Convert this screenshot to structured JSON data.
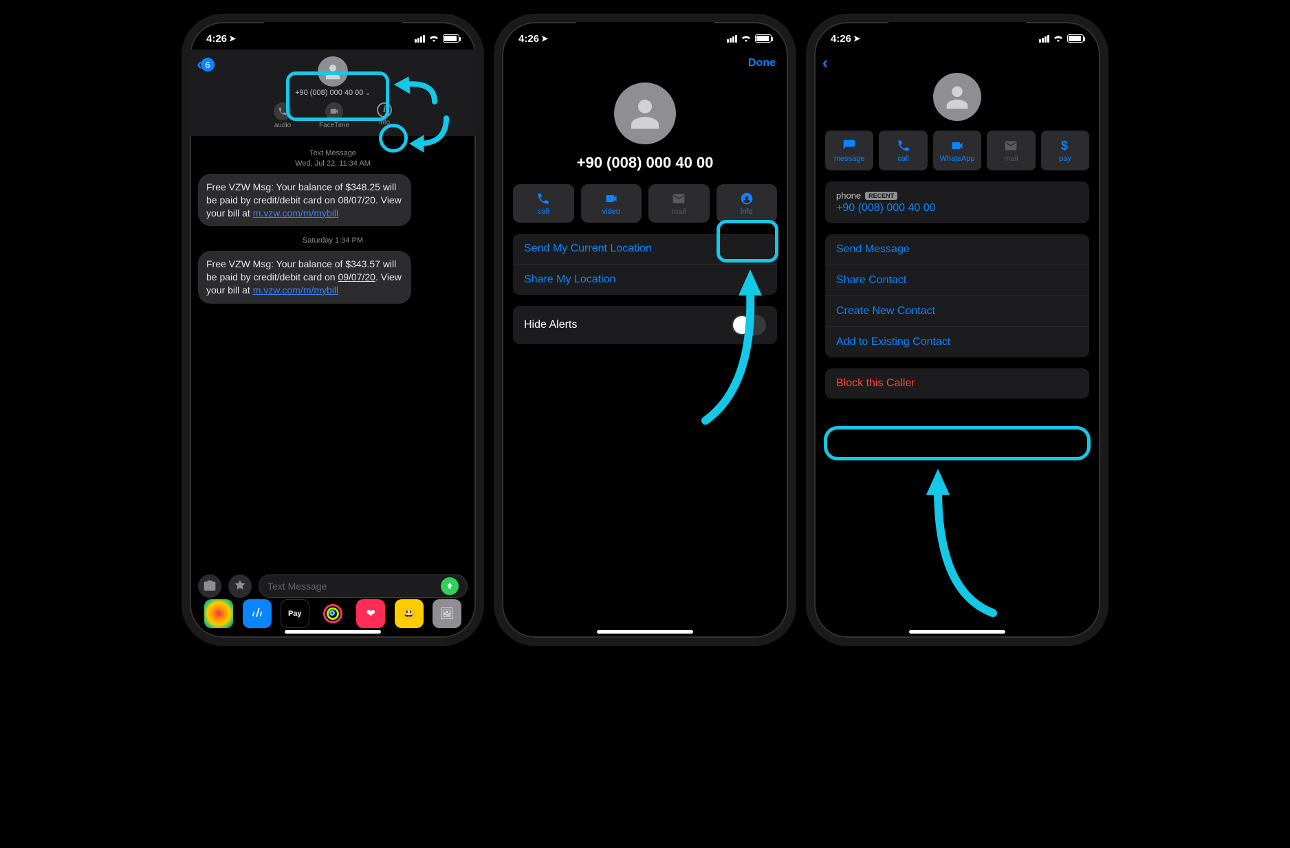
{
  "status": {
    "time": "4:26",
    "loc_icon": "➤"
  },
  "screen1": {
    "back_badge": "6",
    "contact_phone": "+90 (008) 000 40 00",
    "qa": {
      "audio": "audio",
      "facetime": "FaceTime",
      "info": "info"
    },
    "msg1": {
      "meta_line1": "Text Message",
      "meta_line2": "Wed, Jul 22, 11:34 AM",
      "text_a": "Free VZW Msg: Your balance of $348.25 will be paid by credit/debit card on 08/07/20. View your bill at ",
      "link": "m.vzw.com/m/mybill"
    },
    "msg2": {
      "meta": "Saturday 1:34 PM",
      "text_a": "Free VZW Msg: Your balance of $343.57 will be paid by credit/debit card on ",
      "date_txt": "09/07/20",
      "text_b": ". View your bill at ",
      "link": "m.vzw.com/m/mybill"
    },
    "compose_placeholder": "Text Message",
    "apay": "Pay"
  },
  "screen2": {
    "done": "Done",
    "phone": "+90 (008) 000 40 00",
    "actions": {
      "call": "call",
      "video": "video",
      "mail": "mail",
      "info": "info"
    },
    "send_loc": "Send My Current Location",
    "share_loc": "Share My Location",
    "hide_alerts": "Hide Alerts"
  },
  "screen3": {
    "actions": {
      "message": "message",
      "call": "call",
      "whatsapp": "WhatsApp",
      "mail": "mail",
      "pay": "pay"
    },
    "phone_label": "phone",
    "recent": "RECENT",
    "phone_value": "+90 (008) 000 40 00",
    "send_message": "Send Message",
    "share_contact": "Share Contact",
    "create_contact": "Create New Contact",
    "add_contact": "Add to Existing Contact",
    "block": "Block this Caller"
  }
}
